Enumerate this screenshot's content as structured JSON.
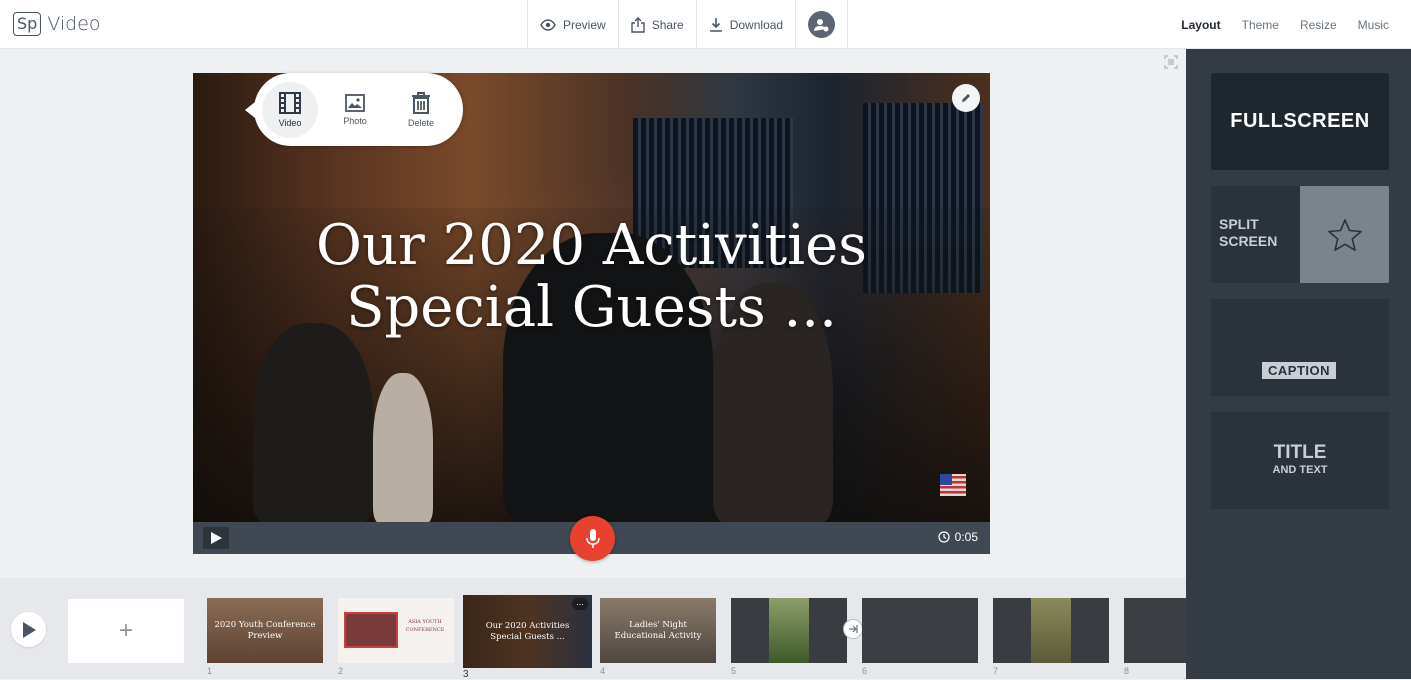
{
  "app": {
    "logo_mark": "Sp",
    "name": "Video"
  },
  "toolbar": {
    "preview_label": "Preview",
    "share_label": "Share",
    "download_label": "Download"
  },
  "right_tabs": [
    "Layout",
    "Theme",
    "Resize",
    "Music"
  ],
  "active_tab": "Layout",
  "layouts": {
    "fullscreen": "FULLSCREEN",
    "split_line1": "SPLIT",
    "split_line2": "SCREEN",
    "caption": "CAPTION",
    "title_line1": "TITLE",
    "title_line2": "AND TEXT"
  },
  "stage": {
    "title_line1": "Our 2020 Activities",
    "title_line2": "Special Guests ..."
  },
  "popover": {
    "video": "Video",
    "photo": "Photo",
    "delete": "Delete"
  },
  "player": {
    "time": "0:05"
  },
  "timeline": {
    "add_symbol": "+",
    "slides": [
      {
        "num": "1",
        "text": "2020 Youth Conference Preview",
        "bg": "#7a5a45"
      },
      {
        "num": "2",
        "text": "ASIA YOUTH CONFERENCE",
        "bg": "#f4f1ee"
      },
      {
        "num": "3",
        "text": "Our 2020 Activities Special Guests ...",
        "bg": "#2e2a26"
      },
      {
        "num": "4",
        "text": "Ladies' Night Educational Activity",
        "bg": "#6a6258"
      },
      {
        "num": "5",
        "text": "",
        "bg": "#393c40"
      },
      {
        "num": "6",
        "text": "",
        "bg": "#3b3f43"
      },
      {
        "num": "7",
        "text": "",
        "bg": "#393c40"
      },
      {
        "num": "8",
        "text": "",
        "bg": "#3b3f43"
      }
    ]
  },
  "colors": {
    "accent_red": "#e8412f",
    "panel": "#333c45"
  }
}
